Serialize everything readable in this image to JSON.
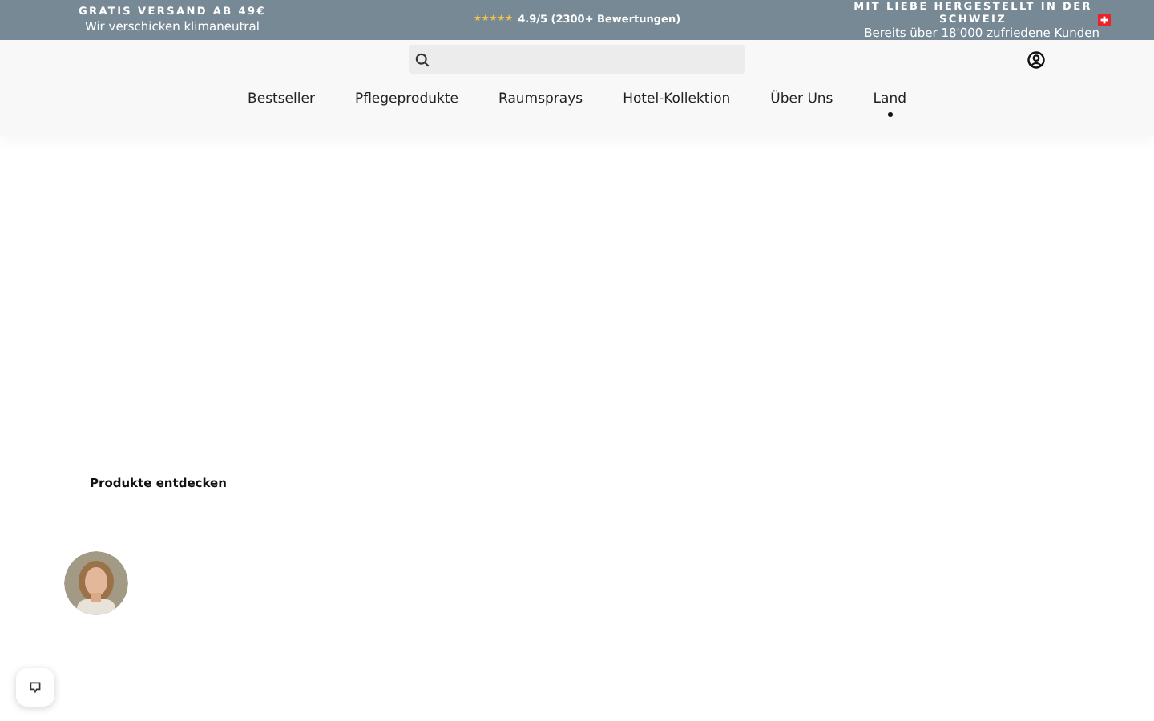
{
  "announcement_bar": {
    "left": {
      "title": "GRATIS VERSAND AB 49€",
      "subtitle": "Wir verschicken klimaneutral"
    },
    "center": {
      "stars": "★★★★★",
      "rating": "4.9/5 (2300+ Bewertungen)"
    },
    "right": {
      "title": "MIT LIEBE HERGESTELLT IN DER SCHWEIZ",
      "subtitle": "Bereits über 18'000 zufriedene Kunden"
    }
  },
  "nav": [
    {
      "label": "Bestseller",
      "selected": false
    },
    {
      "label": "Pflegeprodukte",
      "selected": false
    },
    {
      "label": "Raumsprays",
      "selected": false
    },
    {
      "label": "Hotel-Kollektion",
      "selected": false
    },
    {
      "label": "Über Uns",
      "selected": false
    },
    {
      "label": "Land",
      "selected": true
    }
  ],
  "section_title": "Produkte entdecken"
}
